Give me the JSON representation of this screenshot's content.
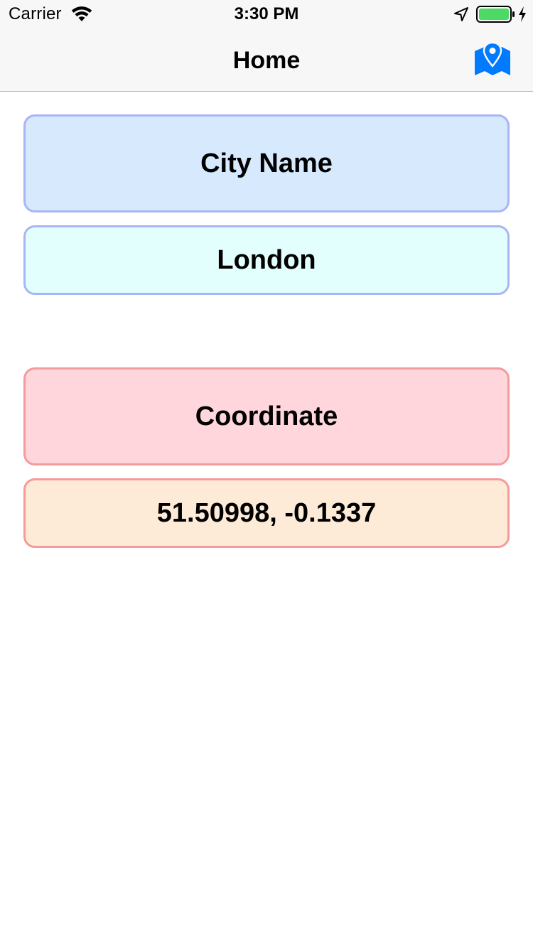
{
  "status_bar": {
    "carrier": "Carrier",
    "time": "3:30 PM",
    "icons": [
      "wifi-icon",
      "location-arrow-icon",
      "battery-icon",
      "charging-icon"
    ],
    "battery_color": "#4cd964"
  },
  "nav_bar": {
    "title": "Home",
    "right_button_icon": "map-pin-icon",
    "accent_color": "#007aff"
  },
  "city_section": {
    "label": "City Name",
    "value": "London"
  },
  "coordinate_section": {
    "label": "Coordinate",
    "value": "51.50998, -0.1337"
  }
}
